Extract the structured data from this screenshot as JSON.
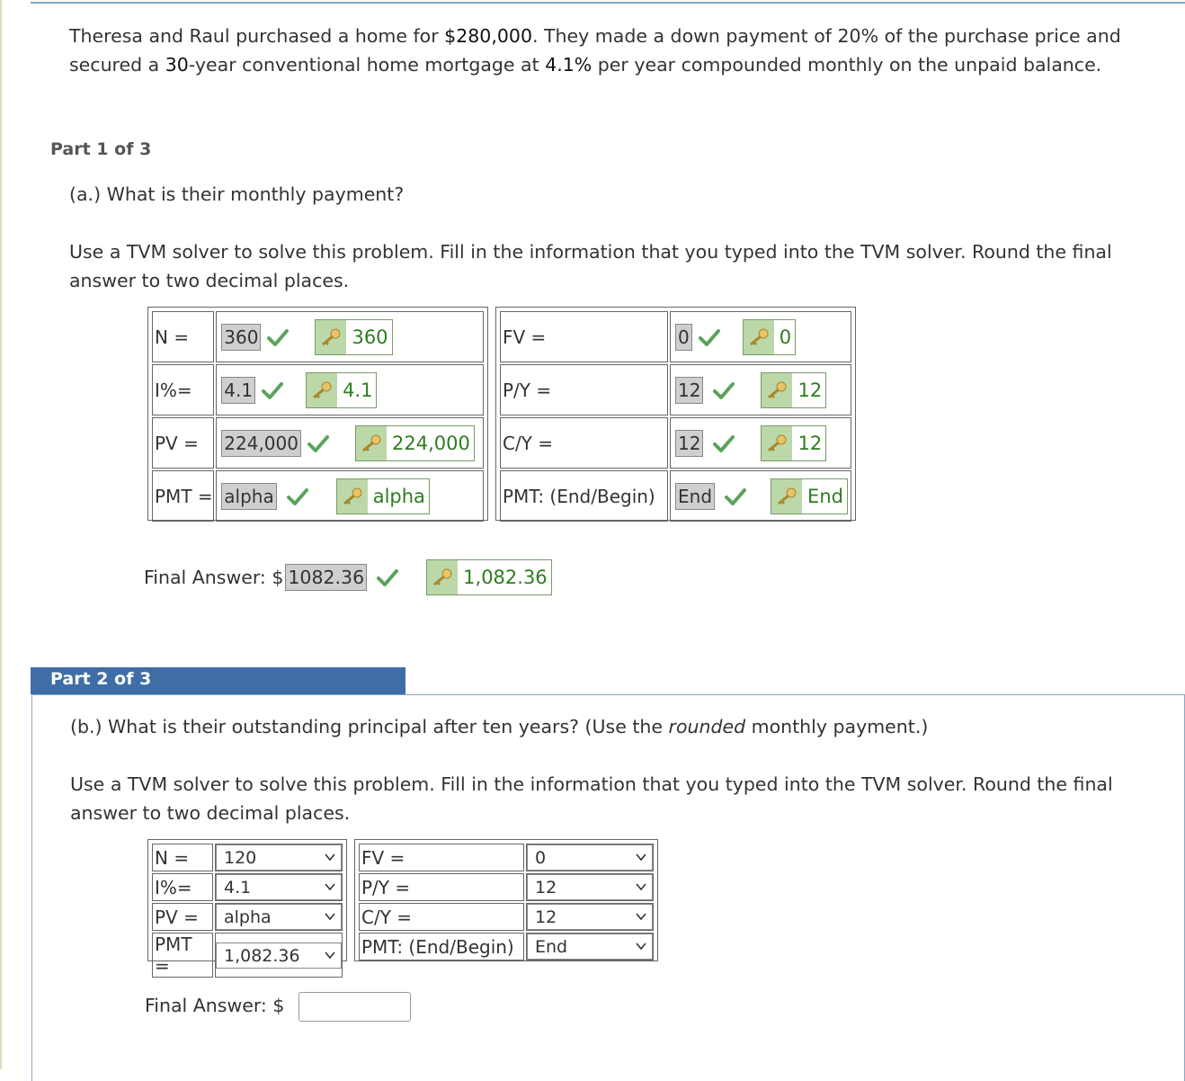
{
  "problem": {
    "part_a": "Theresa and Raul purchased a home for ",
    "price": "$280,000",
    "part_b": ". They made a down payment of 20% of the purchase price and",
    "part_c": "secured a ",
    "years": "30",
    "part_d": "-year conventional home mortgage at ",
    "rate": "4.1%",
    "part_e": " per year compounded monthly on the unpaid balance."
  },
  "part1": {
    "label": "Part 1 of 3",
    "question": "(a.) What is their monthly payment?",
    "instructions_line1": "Use a TVM solver to solve this problem. Fill in the information that you typed into the TVM solver. Round the final",
    "instructions_line2": "answer to two decimal places.",
    "left_rows": [
      {
        "label": "N =",
        "value": "360",
        "key": "360"
      },
      {
        "label": "I%=",
        "value": "4.1",
        "key": "4.1"
      },
      {
        "label": "PV =",
        "value": "224,000",
        "key": "224,000"
      },
      {
        "label": "PMT =",
        "value": "alpha",
        "key": "alpha"
      }
    ],
    "right_rows": [
      {
        "label": "FV =",
        "value": "0",
        "key": "0"
      },
      {
        "label": "P/Y =",
        "value": "12",
        "key": "12"
      },
      {
        "label": "C/Y =",
        "value": "12",
        "key": "12"
      },
      {
        "label": "PMT: (End/Begin)",
        "value": "End",
        "key": "End"
      }
    ],
    "final_label": "Final Answer: $",
    "final_value": "1082.36",
    "final_key": "1,082.36"
  },
  "part2": {
    "label": "Part 2 of 3",
    "question_pre": "(b.) What is their outstanding principal after ten years? (Use the ",
    "question_em": "rounded",
    "question_post": " monthly payment.)",
    "instructions_line1": "Use a TVM solver to solve this problem. Fill in the information that you typed into the TVM solver. Round the final",
    "instructions_line2": "answer to two decimal places.",
    "left_rows": [
      {
        "label": "N =",
        "value": "120"
      },
      {
        "label": "I%=",
        "value": "4.1"
      },
      {
        "label": "PV =",
        "value": "alpha"
      },
      {
        "label": "PMT =",
        "value": "1,082.36"
      }
    ],
    "right_rows": [
      {
        "label": "FV =",
        "value": "0"
      },
      {
        "label": "P/Y =",
        "value": "12"
      },
      {
        "label": "C/Y =",
        "value": "12"
      },
      {
        "label": "PMT: (End/Begin)",
        "value": "End"
      }
    ],
    "final_label": "Final Answer: $",
    "final_value": ""
  },
  "icons": {
    "check": "checkmark-icon",
    "key": "key-icon",
    "caret": "chevron-down-icon"
  },
  "colors": {
    "accent": "#3f6ea6",
    "correct": "#2d7d1e",
    "check": "#5aa35a"
  }
}
